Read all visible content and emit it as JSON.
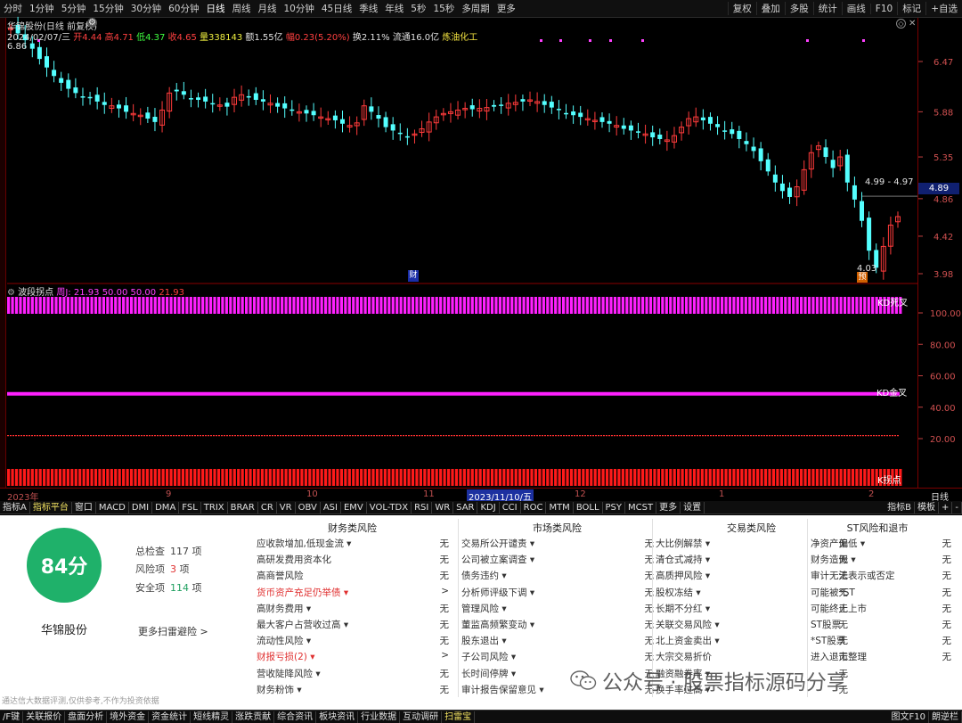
{
  "toolbar": {
    "periods": [
      "分时",
      "1分钟",
      "5分钟",
      "15分钟",
      "30分钟",
      "60分钟",
      "日线",
      "周线",
      "月线",
      "10分钟",
      "45日线",
      "季线",
      "年线",
      "5秒",
      "15秒",
      "多周期",
      "更多"
    ],
    "active_period": "日线",
    "right_buttons": [
      "复权",
      "叠加",
      "多股",
      "统计",
      "画线",
      "F10",
      "标记",
      "+自选"
    ]
  },
  "chart_header": {
    "title": "华锦股份(日线 前复权)",
    "date": "2024/02/07/三",
    "open": "开4.44",
    "high": "高4.71",
    "low": "低4.37",
    "close": "收4.65",
    "volume": "量338143",
    "amount": "额1.55亿",
    "change": "幅0.23(5.20%)",
    "turnover": "换2.11%",
    "float_shares": "流通16.0亿",
    "sector": "炼油化工",
    "left_high": "6.86"
  },
  "price_axis": [
    "6.47",
    "5.88",
    "5.35",
    "4.86",
    "4.42",
    "3.98"
  ],
  "current_price": "4.89",
  "range_note": "4.99 - 4.97",
  "low_note": "4.03",
  "marker_cai": "财",
  "marker_yu": "预",
  "indicator_header": {
    "name": "波段拐点",
    "prefix": "周J:",
    "v1": "21.93",
    "v2": "50.00",
    "v3": "50.00",
    "v4": "21.93"
  },
  "indicator_axis": [
    "100.00",
    "80.00",
    "60.00",
    "40.00",
    "20.00"
  ],
  "indicator_labels": {
    "top": "KD死叉",
    "mid": "KD金叉",
    "bottom": "K拐点"
  },
  "date_axis": [
    {
      "label": "2023年"
    },
    {
      "label": "9"
    },
    {
      "label": "10"
    },
    {
      "label": "11"
    },
    {
      "label": "2023/11/10/五",
      "selected": true
    },
    {
      "label": "12"
    },
    {
      "label": "1"
    },
    {
      "label": "2"
    }
  ],
  "date_axis_right": "日线",
  "indicator_tabs": [
    "指标A",
    "指标平台",
    "窗口",
    "MACD",
    "DMI",
    "DMA",
    "FSL",
    "TRIX",
    "BRAR",
    "CR",
    "VR",
    "OBV",
    "ASI",
    "EMV",
    "VOL-TDX",
    "RSI",
    "WR",
    "SAR",
    "KDJ",
    "CCI",
    "ROC",
    "MTM",
    "BOLL",
    "PSY",
    "MCST",
    "更多",
    "设置"
  ],
  "indicator_tabs_right": [
    "指标B",
    "模板",
    "+",
    "-"
  ],
  "risk_panel": {
    "score": "84分",
    "stock_name": "华锦股份",
    "total_label": "总检查",
    "total_value": "117",
    "unit": "项",
    "risk_label": "风险项",
    "risk_value": "3",
    "safe_label": "安全项",
    "safe_value": "114",
    "more_link": "更多扫雷避险 >",
    "disclaimer": "通达信大数据评测,仅供参考,不作为投资依据",
    "columns": [
      {
        "title": "财务类风险",
        "items": [
          {
            "name": "应收款增加,低现金流 ▾",
            "value": "无"
          },
          {
            "name": "高研发费用资本化",
            "value": "无"
          },
          {
            "name": "高商誉风险",
            "value": "无"
          },
          {
            "name": "货币资产充足仍举债 ▾",
            "value": ">",
            "red": true
          },
          {
            "name": "高财务费用 ▾",
            "value": "无"
          },
          {
            "name": "最大客户占营收过高 ▾",
            "value": "无"
          },
          {
            "name": "流动性风险 ▾",
            "value": "无"
          },
          {
            "name": "财报亏损(2) ▾",
            "value": ">",
            "red": true
          },
          {
            "name": "营收陡降风险 ▾",
            "value": "无"
          },
          {
            "name": "财务粉饰 ▾",
            "value": "无"
          }
        ]
      },
      {
        "title": "市场类风险",
        "items": [
          {
            "name": "交易所公开谴责 ▾",
            "value": "无"
          },
          {
            "name": "公司被立案调查 ▾",
            "value": "无"
          },
          {
            "name": "债务违约 ▾",
            "value": "无"
          },
          {
            "name": "分析师评级下调 ▾",
            "value": "无"
          },
          {
            "name": "管理风险 ▾",
            "value": "无"
          },
          {
            "name": "董监高频繁变动 ▾",
            "value": "无"
          },
          {
            "name": "股东退出 ▾",
            "value": "无"
          },
          {
            "name": "子公司风险 ▾",
            "value": "无"
          },
          {
            "name": "长时间停牌 ▾",
            "value": "无"
          },
          {
            "name": "审计报告保留意见 ▾",
            "value": "无"
          }
        ]
      },
      {
        "title": "交易类风险",
        "items": [
          {
            "name": "大比例解禁 ▾",
            "value": "无"
          },
          {
            "name": "清仓式减持 ▾",
            "value": "无"
          },
          {
            "name": "高质押风险 ▾",
            "value": "无"
          },
          {
            "name": "股权冻结 ▾",
            "value": "无"
          },
          {
            "name": "长期不分红 ▾",
            "value": "无"
          },
          {
            "name": "关联交易风险 ▾",
            "value": "无"
          },
          {
            "name": "北上资金卖出 ▾",
            "value": "无"
          },
          {
            "name": "大宗交易折价",
            "value": "无"
          },
          {
            "name": "融资融券率 ▾",
            "value": "无"
          },
          {
            "name": "换手率过高 ▾",
            "value": "无"
          }
        ]
      },
      {
        "title": "ST风险和退市",
        "items": [
          {
            "name": "净资产偏低 ▾",
            "value": "无"
          },
          {
            "name": "财务造假 ▾",
            "value": "无"
          },
          {
            "name": "审计无法表示或否定",
            "value": "无"
          },
          {
            "name": "可能被*ST",
            "value": "无"
          },
          {
            "name": "可能终止上市",
            "value": "无"
          },
          {
            "name": "ST股票",
            "value": "无"
          },
          {
            "name": "*ST股票",
            "value": "无"
          },
          {
            "name": "进入退市整理",
            "value": "无"
          }
        ]
      }
    ]
  },
  "watermark": "公众号 · 股票指标源码分享",
  "bottom_tabs": [
    "/F键",
    "关联报价",
    "盘面分析",
    "境外资金",
    "资金统计",
    "短线精灵",
    "涨跌贡献",
    "综合资讯",
    "板块资讯",
    "行业数据",
    "互动调研",
    "扫雷宝"
  ],
  "bottom_active": "扫雷宝",
  "bottom_right": [
    "图文F10",
    "朗逆栏"
  ],
  "colors": {
    "up": "#ff3b3b",
    "down": "#54ffff",
    "magenta": "#ff20ff",
    "axis": "#c04040",
    "score_green": "#1fb16a"
  }
}
